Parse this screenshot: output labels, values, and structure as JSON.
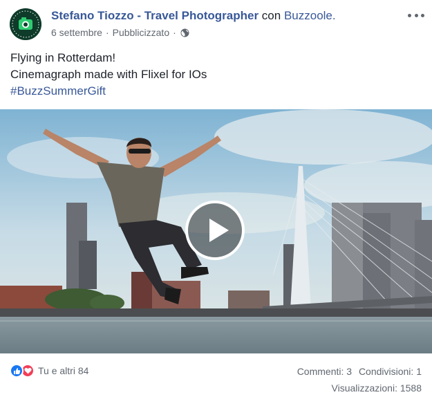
{
  "post": {
    "author": "Stefano Tiozzo - Travel Photographer",
    "with_label": "con",
    "partner": "Buzzoole.",
    "date": "6 settembre",
    "separator": "·",
    "sponsored": "Pubblicizzato",
    "privacy_icon": "globe-icon",
    "more_icon": "more-options-icon",
    "text_lines": [
      "Flying in Rotterdam!",
      "Cinemagraph made with Flixel for IOs"
    ],
    "hashtag": "#BuzzSummerGift"
  },
  "video": {
    "play_icon": "play-icon"
  },
  "footer": {
    "reaction_icons": [
      "like-icon",
      "love-icon"
    ],
    "reactions_text": "Tu e altri 84",
    "comments": "Commenti: 3",
    "shares": "Condivisioni: 1",
    "views": "Visualizzazioni: 1588"
  },
  "colors": {
    "link": "#385898",
    "secondary_text": "#606770",
    "like": "#1877f2",
    "love": "#f33e58"
  }
}
